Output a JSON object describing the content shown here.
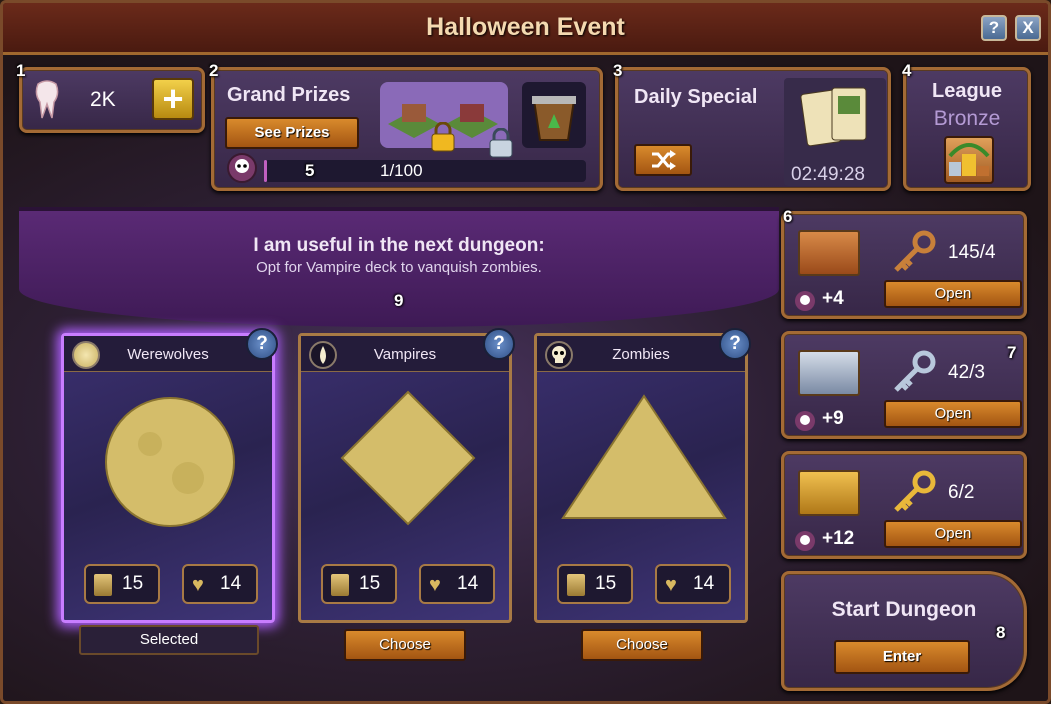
{
  "window": {
    "title": "Halloween Event",
    "help_label": "?",
    "close_label": "X"
  },
  "callouts": [
    "1",
    "2",
    "3",
    "4",
    "5",
    "6",
    "7",
    "8",
    "9"
  ],
  "currency": {
    "amount": "2K",
    "add_label": "+"
  },
  "grand_prizes": {
    "title": "Grand Prizes",
    "button": "See Prizes",
    "progress": "1/100",
    "progress_fraction": 0.01
  },
  "daily_special": {
    "title": "Daily Special",
    "timer": "02:49:28"
  },
  "league": {
    "title": "League",
    "rank": "Bronze"
  },
  "banner": {
    "headline": "I am useful in the next dungeon:",
    "subline": "Opt for Vampire deck to vanquish zombies."
  },
  "decks": [
    {
      "name": "Werewolves",
      "cards": "15",
      "hearts": "14",
      "action": "Selected",
      "shape": "circle"
    },
    {
      "name": "Vampires",
      "cards": "15",
      "hearts": "14",
      "action": "Choose",
      "shape": "diamond"
    },
    {
      "name": "Zombies",
      "cards": "15",
      "hearts": "14",
      "action": "Choose",
      "shape": "triangle"
    }
  ],
  "chests": [
    {
      "bonus": "+4",
      "keys": "145/4",
      "button": "Open",
      "color": "#c8722e",
      "key_color": "#c8803a"
    },
    {
      "bonus": "+9",
      "keys": "42/3",
      "button": "Open",
      "color": "#9fb0c8",
      "key_color": "#b8c8dc"
    },
    {
      "bonus": "+12",
      "keys": "6/2",
      "button": "Open",
      "color": "#e0a23a",
      "key_color": "#e8b83a"
    }
  ],
  "dungeon": {
    "title": "Start Dungeon",
    "button": "Enter"
  },
  "colors": {
    "accent_orange": "#d98a2c",
    "panel_purple": "#4d3a63",
    "frame_bronze": "#a36a35",
    "selected_glow": "#c87dff",
    "title_text": "#f4d9b0"
  }
}
